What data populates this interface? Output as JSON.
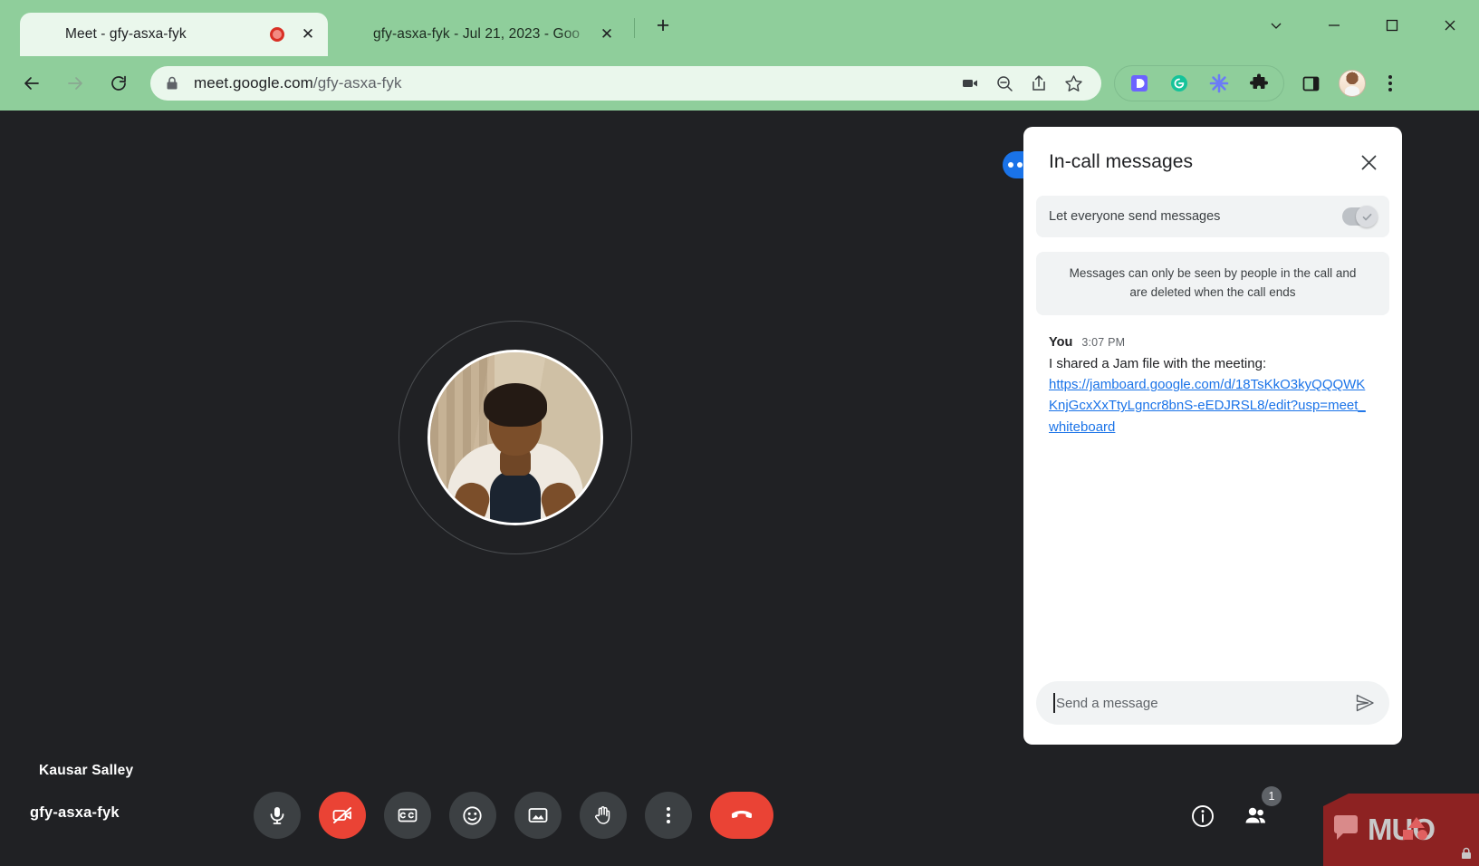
{
  "browser": {
    "tabs": [
      {
        "title": "Meet - gfy-asxa-fyk",
        "favicon": "google-meet-icon",
        "recording": true,
        "active": true,
        "close_label": "✕"
      },
      {
        "title": "gfy-asxa-fyk - Jul 21, 2023 - Goo",
        "favicon": "google-jamboard-icon",
        "recording": false,
        "active": false,
        "close_label": "✕"
      }
    ],
    "new_tab_label": "+",
    "window_controls": {
      "minimize_all": "⌄",
      "minimize": "─",
      "maximize": "□",
      "close": "✕"
    },
    "nav": {
      "back": "←",
      "forward": "→",
      "reload": "⟳"
    },
    "omnibox": {
      "lock_icon": "lock-icon",
      "url_domain": "meet.google.com",
      "url_path": "/gfy-asxa-fyk",
      "actions": [
        "camera-icon",
        "zoom-out-icon",
        "share-icon",
        "bookmark-star-icon"
      ]
    },
    "extensions": [
      "dashlane-icon",
      "grammarly-icon",
      "asterisk-icon",
      "puzzle-extensions-icon"
    ],
    "side_panel_icon": "side-panel-icon",
    "profile_icon": "profile-avatar",
    "menu_icon": "three-dot-menu-icon"
  },
  "meet": {
    "self_tile": {
      "name": "Kausar Salley"
    },
    "meeting_code": "gfy-asxa-fyk",
    "more_pill_icon": "three-dots-blue-pill",
    "controls": [
      {
        "name": "microphone",
        "label": "Turn off microphone",
        "state": "on",
        "danger": false
      },
      {
        "name": "camera",
        "label": "Turn on camera",
        "state": "off",
        "danger": true
      },
      {
        "name": "captions",
        "label": "Turn on captions",
        "state": "off",
        "danger": false
      },
      {
        "name": "reactions",
        "label": "Send a reaction",
        "state": "off",
        "danger": false
      },
      {
        "name": "present",
        "label": "Present now",
        "state": "off",
        "danger": false
      },
      {
        "name": "raise-hand",
        "label": "Raise hand",
        "state": "off",
        "danger": false
      },
      {
        "name": "more-options",
        "label": "More options",
        "state": "off",
        "danger": false
      },
      {
        "name": "leave-call",
        "label": "Leave call",
        "state": "off",
        "danger": true
      }
    ],
    "right_controls": [
      {
        "name": "meeting-details",
        "label": "Meeting details",
        "badge": null
      },
      {
        "name": "people",
        "label": "Show everyone",
        "badge": "1"
      }
    ],
    "watermark": "MUO"
  },
  "chat": {
    "title": "In-call messages",
    "close_icon": "close-icon",
    "setting": {
      "label": "Let everyone send messages",
      "enabled": true,
      "toggle_check": "✓"
    },
    "notice": "Messages can only be seen by people in the call and are deleted when the call ends",
    "messages": [
      {
        "author": "You",
        "time": "3:07 PM",
        "text": "I shared a Jam file with the meeting:",
        "link": "https://jamboard.google.com/d/18TsKkO3kyQQQWKKnjGcxXxTtyLgncr8bnS-eEDJRSL8/edit?usp=meet_whiteboard"
      }
    ],
    "compose": {
      "placeholder": "Send a message",
      "value": "",
      "send_icon": "send-icon"
    }
  },
  "colors": {
    "chrome_theme": "#8fce9b",
    "meet_bg": "#202124",
    "accent_blue": "#1a73e8",
    "danger_red": "#ea4335",
    "link_blue": "#1a73e8",
    "panel_bg": "#ffffff",
    "watermark_red": "#8d2222"
  }
}
